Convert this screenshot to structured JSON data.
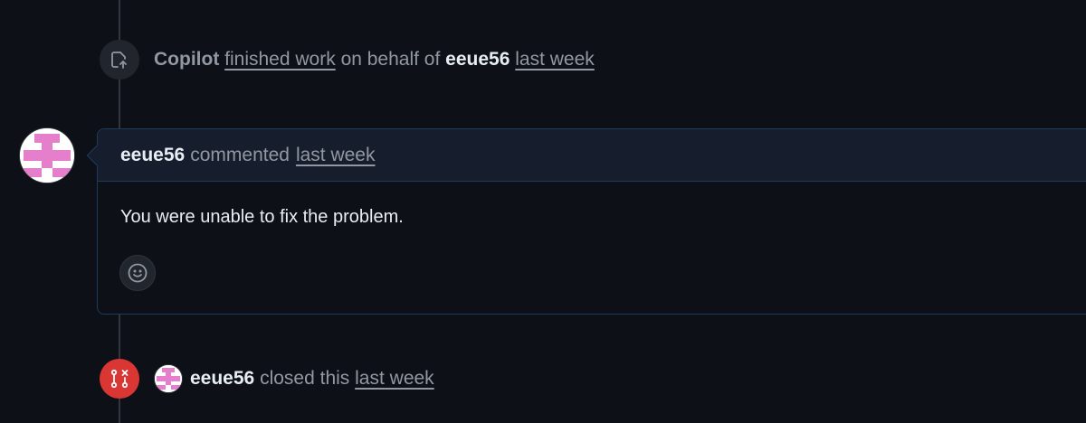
{
  "events": {
    "copilot_event": {
      "actor": "Copilot",
      "action_link": "finished work",
      "connector": "on behalf of",
      "on_behalf_user": "eeue56",
      "time": "last week",
      "icon": "copilot-task-icon"
    },
    "closed_event": {
      "actor": "eeue56",
      "action": "closed this",
      "time": "last week",
      "icon": "pull-request-closed-icon"
    }
  },
  "comment": {
    "author": "eeue56",
    "verb": "commented",
    "time": "last week",
    "body": "You were unable to fix the problem.",
    "reaction_icon": "smiley-icon"
  },
  "colors": {
    "background": "#0d1117",
    "closed_badge": "#da3633",
    "avatar_pink": "#e67fcb",
    "comment_header_bg": "#161e2e",
    "comment_border": "#1f3a5f"
  }
}
